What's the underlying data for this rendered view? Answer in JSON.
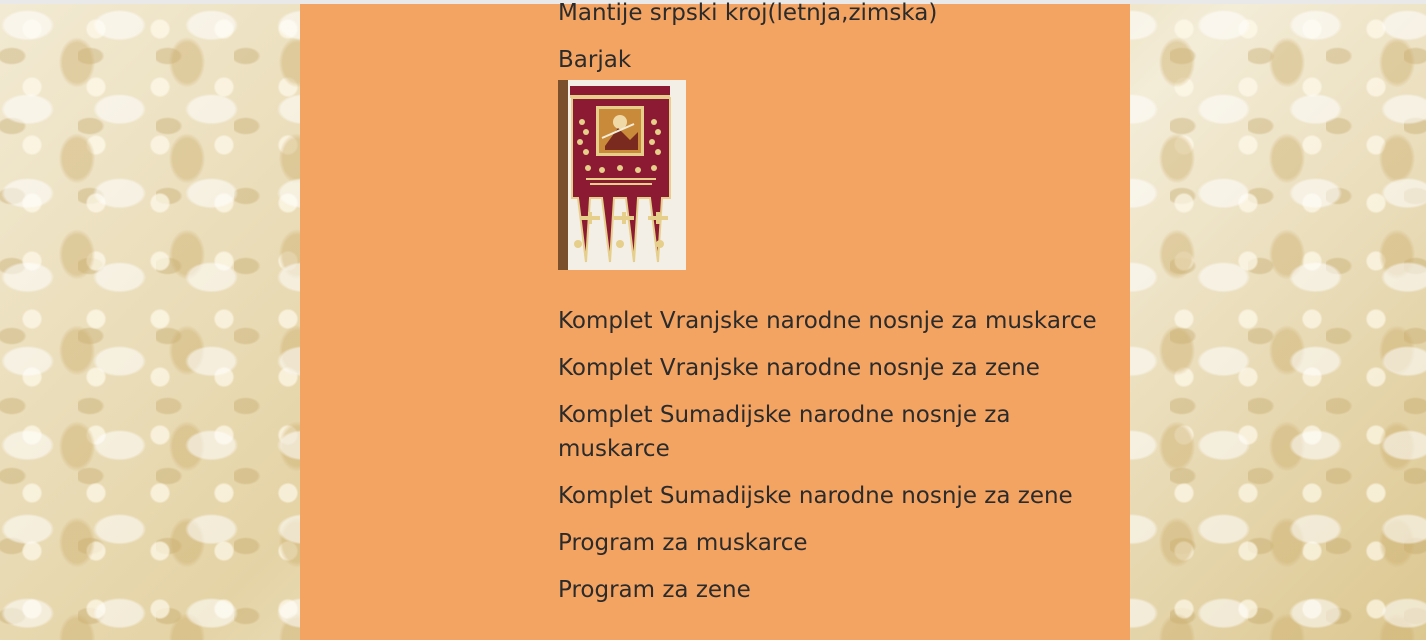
{
  "colors": {
    "panel_background": "#f4a462",
    "text": "#2b2b2b",
    "page_background": "#ece1c0"
  },
  "menu": {
    "items": [
      {
        "label": "Mantije srpski kroj(letnja,zimska)"
      },
      {
        "label": "Barjak"
      },
      {
        "label": "Komplet Vranjske narodne nosnje za muskarce"
      },
      {
        "label": "Komplet Vranjske narodne nosnje za zene"
      },
      {
        "label": "Komplet Sumadijske narodne nosnje za muskarce"
      },
      {
        "label": "Komplet Sumadijske narodne nosnje za zene"
      },
      {
        "label": "Program za muskarce"
      },
      {
        "label": "Program za zene"
      }
    ]
  },
  "banner_image": {
    "icon": "church-banner-image"
  }
}
